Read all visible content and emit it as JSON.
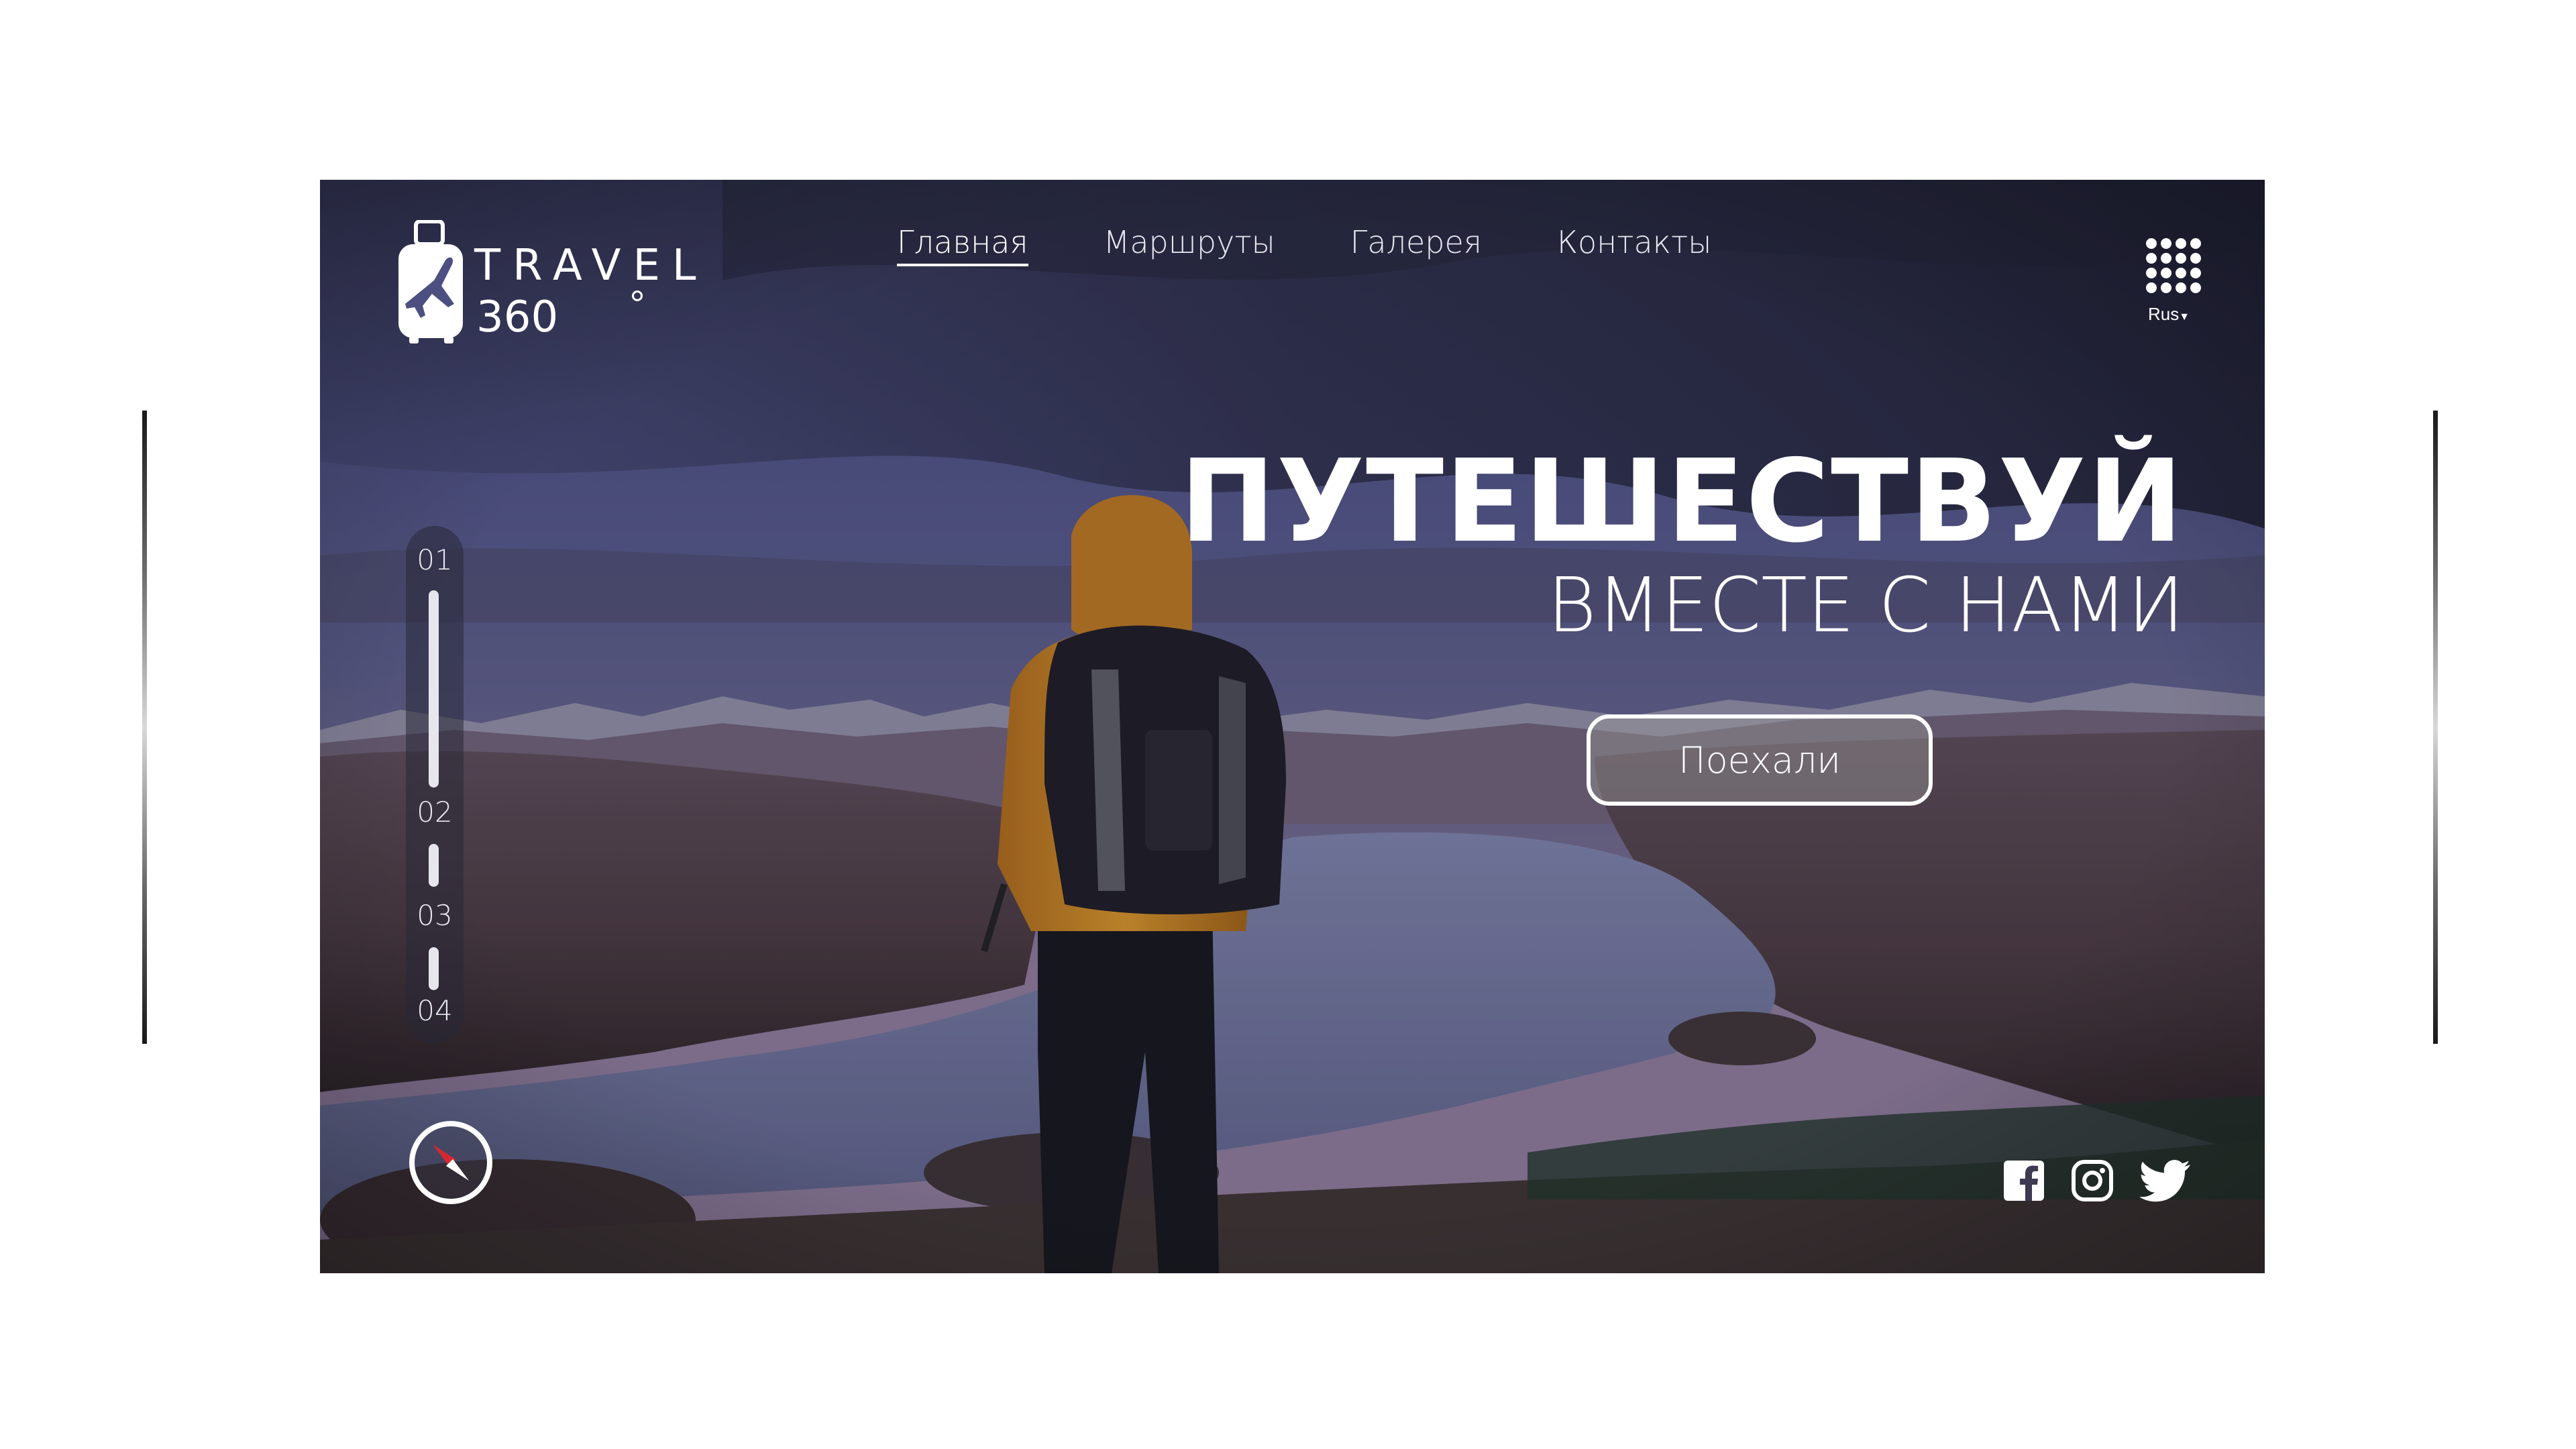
{
  "brand": {
    "word": "TRAVEL",
    "number": "360"
  },
  "nav": {
    "items": [
      {
        "label": "Главная",
        "active": true
      },
      {
        "label": "Маршруты",
        "active": false
      },
      {
        "label": "Галерея",
        "active": false
      },
      {
        "label": "Контакты",
        "active": false
      }
    ]
  },
  "header": {
    "apps_icon": "grid-icon",
    "language": "Rus"
  },
  "hero": {
    "title": "ПУТЕШЕСТВУЙ",
    "subtitle": "ВМЕСТЕ С НАМИ",
    "cta_label": "Поехали"
  },
  "pager": {
    "items": [
      "01",
      "02",
      "03",
      "04"
    ],
    "active_index": 0
  },
  "social": {
    "icons": [
      "facebook-icon",
      "instagram-icon",
      "twitter-icon"
    ]
  },
  "colors": {
    "text": "#ffffff",
    "sky_dark": "#2e2f45",
    "sky_light": "#5a5c8f",
    "accent_jacket": "#c8871e"
  }
}
